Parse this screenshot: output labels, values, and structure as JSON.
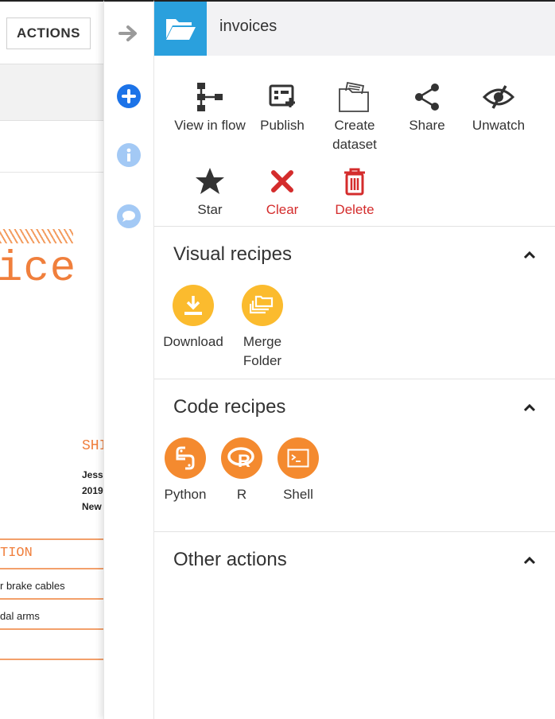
{
  "background": {
    "actions_button": "ACTIONS",
    "doc_title_fragment": "ice",
    "ship_label": "SHI",
    "ship_lines": [
      "Jess",
      "2019",
      "New"
    ],
    "description_header": "TION",
    "rows": [
      "r brake cables",
      "dal arms"
    ]
  },
  "header": {
    "title": "invoices"
  },
  "actions": [
    {
      "label": "View in flow",
      "icon": "flow-icon"
    },
    {
      "label": "Publish",
      "icon": "publish-icon"
    },
    {
      "label": "Create dataset",
      "icon": "create-dataset-icon"
    },
    {
      "label": "Share",
      "icon": "share-icon"
    },
    {
      "label": "Unwatch",
      "icon": "unwatch-icon"
    },
    {
      "label": "Star",
      "icon": "star-icon"
    },
    {
      "label": "Clear",
      "icon": "clear-icon"
    },
    {
      "label": "Delete",
      "icon": "trash-icon"
    }
  ],
  "sections": {
    "visual": {
      "title": "Visual recipes",
      "items": [
        {
          "label": "Download",
          "icon": "download-icon"
        },
        {
          "label": "Merge Folder",
          "icon": "merge-folder-icon"
        }
      ]
    },
    "code": {
      "title": "Code recipes",
      "items": [
        {
          "label": "Python",
          "icon": "python-icon"
        },
        {
          "label": "R",
          "icon": "r-icon"
        },
        {
          "label": "Shell",
          "icon": "shell-icon"
        }
      ]
    },
    "other": {
      "title": "Other actions"
    }
  },
  "colors": {
    "accent_blue": "#2aa0dd",
    "danger_red": "#d42c2c",
    "recipe_yellow": "#fbbb2e",
    "recipe_orange": "#f48a2f",
    "doc_orange": "#f07f3c"
  }
}
